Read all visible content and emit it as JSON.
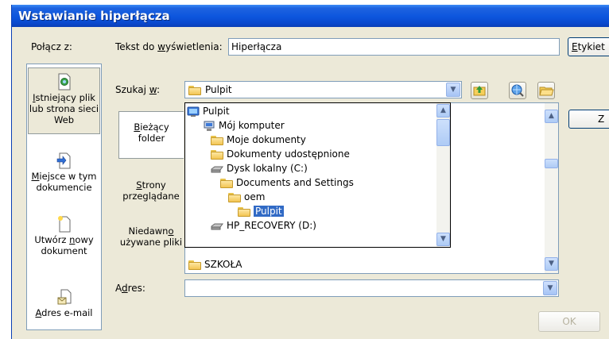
{
  "window": {
    "title": "Wstawianie hiperłącza"
  },
  "labels": {
    "link_to": "Połącz z:",
    "display_text_prefix": "Tekst do ",
    "display_text_ul": "w",
    "display_text_suffix": "yświetlenia:",
    "look_in_prefix": "Szukaj ",
    "look_in_ul": "w",
    "look_in_suffix": ":",
    "address_prefix": "A",
    "address_ul": "d",
    "address_suffix": "res:"
  },
  "display_text_value": "Hiperłącza",
  "look_in_value": "Pulpit",
  "left_nav": [
    {
      "ul": "I",
      "label": "stniejący plik lub strona sieci Web",
      "icon": "existing-file-icon",
      "selected": true
    },
    {
      "ul": "M",
      "label": "iejsce w tym dokumencie",
      "icon": "place-in-document-icon",
      "selected": false
    },
    {
      "pre": "Utwórz ",
      "ul": "n",
      "label": "owy dokument",
      "icon": "new-document-icon",
      "selected": false
    },
    {
      "ul": "A",
      "label": "dres e-mail",
      "icon": "email-icon",
      "selected": false
    }
  ],
  "middle_nav": [
    {
      "ul": "B",
      "label": "ieżący folder",
      "selected": true
    },
    {
      "ul": "S",
      "label": "trony przeglądane",
      "selected": false
    },
    {
      "pre": "Niedawn",
      "ul": "o",
      "label": " używane pliki",
      "selected": false
    }
  ],
  "dropdown_items": [
    {
      "label": "Pulpit",
      "icon": "desktop-icon",
      "indent": 0,
      "selected": false
    },
    {
      "label": "Mój komputer",
      "icon": "my-computer-icon",
      "indent": 1,
      "selected": false
    },
    {
      "label": "Moje dokumenty",
      "icon": "folder-icon",
      "indent": 2,
      "selected": false
    },
    {
      "label": "Dokumenty udostępnione",
      "icon": "folder-icon",
      "indent": 2,
      "selected": false
    },
    {
      "label": "Dysk lokalny (C:)",
      "icon": "drive-icon",
      "indent": 2,
      "selected": false
    },
    {
      "label": "Documents and Settings",
      "icon": "folder-icon",
      "indent": 3,
      "selected": false
    },
    {
      "label": "oem",
      "icon": "folder-icon",
      "indent": 4,
      "selected": false
    },
    {
      "label": "Pulpit",
      "icon": "folder-icon",
      "indent": 5,
      "selected": true
    },
    {
      "label": "HP_RECOVERY (D:)",
      "icon": "drive-icon",
      "indent": 2,
      "selected": false
    }
  ],
  "file_list": [
    {
      "label": "SZKOŁA",
      "icon": "folder-icon"
    }
  ],
  "buttons": {
    "bookmark_prefix": "E",
    "bookmark_suffix": "tykiet",
    "right_button_partial": "Z",
    "ok": "OK"
  }
}
